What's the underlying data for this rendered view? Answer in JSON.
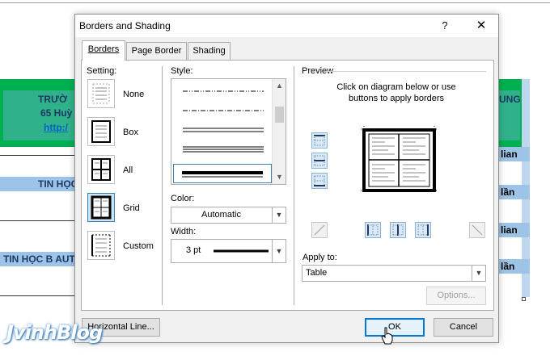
{
  "document": {
    "header_lines": [
      "TRƯỜ",
      "65 Huỳ",
      "http:/"
    ],
    "right_header": "UNG",
    "row_labels": [
      "TIN HỌC",
      "TIN HỌC B AUT"
    ],
    "right_cells": [
      "lian",
      "lần",
      "lian",
      "lần"
    ]
  },
  "dialog": {
    "title": "Borders and Shading",
    "help_label": "?",
    "close_label": "✕",
    "tabs": [
      {
        "label": "Borders",
        "active": true
      },
      {
        "label": "Page Border",
        "active": false
      },
      {
        "label": "Shading",
        "active": false
      }
    ],
    "setting": {
      "label": "Setting:",
      "options": [
        "None",
        "Box",
        "All",
        "Grid",
        "Custom"
      ],
      "selected": "Grid"
    },
    "style": {
      "label": "Style:",
      "selected_index": 4
    },
    "color": {
      "label": "Color:",
      "value": "Automatic"
    },
    "width": {
      "label": "Width:",
      "value": "3 pt"
    },
    "preview": {
      "label": "Preview",
      "instruction": "Click on diagram below or use buttons to apply borders"
    },
    "apply_to": {
      "label": "Apply to:",
      "value": "Table"
    },
    "buttons": {
      "options": "Options...",
      "horizontal_line": "Horizontal Line...",
      "ok": "OK",
      "cancel": "Cancel"
    }
  },
  "watermark": "JvinhBlog",
  "colors": {
    "accent": "#0078d7",
    "selection_fill": "#cce4f7",
    "doc_green": "#00b050",
    "doc_blue": "#9dc3e6"
  }
}
